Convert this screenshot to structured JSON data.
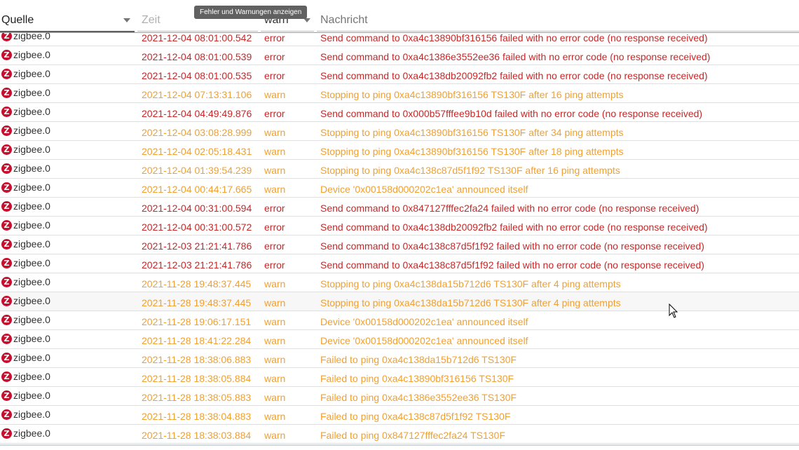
{
  "header": {
    "source": "Quelle",
    "time": "Zeit",
    "severity": "warn",
    "message": "Nachricht",
    "tooltip": "Fehler und Warnungen anzeigen"
  },
  "colors": {
    "error": "#c62828",
    "warn": "#f0a030",
    "zigbee_icon": "#c8102e"
  },
  "rows": [
    {
      "source": "zigbee.0",
      "time": "2021-12-04 08:01:00.542",
      "severity": "error",
      "message": "Send command to 0xa4c13890bf316156 failed with no error code (no response received)"
    },
    {
      "source": "zigbee.0",
      "time": "2021-12-04 08:01:00.539",
      "severity": "error",
      "message": "Send command to 0xa4c1386e3552ee36 failed with no error code (no response received)"
    },
    {
      "source": "zigbee.0",
      "time": "2021-12-04 08:01:00.535",
      "severity": "error",
      "message": "Send command to 0xa4c138db20092fb2 failed with no error code (no response received)"
    },
    {
      "source": "zigbee.0",
      "time": "2021-12-04 07:13:31.106",
      "severity": "warn",
      "message": "Stopping to ping 0xa4c13890bf316156 TS130F after 16 ping attempts"
    },
    {
      "source": "zigbee.0",
      "time": "2021-12-04 04:49:49.876",
      "severity": "error",
      "message": "Send command to 0x000b57fffee9b10d failed with no error code (no response received)"
    },
    {
      "source": "zigbee.0",
      "time": "2021-12-04 03:08:28.999",
      "severity": "warn",
      "message": "Stopping to ping 0xa4c13890bf316156 TS130F after 34 ping attempts"
    },
    {
      "source": "zigbee.0",
      "time": "2021-12-04 02:05:18.431",
      "severity": "warn",
      "message": "Stopping to ping 0xa4c13890bf316156 TS130F after 18 ping attempts"
    },
    {
      "source": "zigbee.0",
      "time": "2021-12-04 01:39:54.239",
      "severity": "warn",
      "message": "Stopping to ping 0xa4c138c87d5f1f92 TS130F after 16 ping attempts"
    },
    {
      "source": "zigbee.0",
      "time": "2021-12-04 00:44:17.665",
      "severity": "warn",
      "message": "Device '0x00158d000202c1ea' announced itself"
    },
    {
      "source": "zigbee.0",
      "time": "2021-12-04 00:31:00.594",
      "severity": "error",
      "message": "Send command to 0x847127fffec2fa24 failed with no error code (no response received)"
    },
    {
      "source": "zigbee.0",
      "time": "2021-12-04 00:31:00.572",
      "severity": "error",
      "message": "Send command to 0xa4c138db20092fb2 failed with no error code (no response received)"
    },
    {
      "source": "zigbee.0",
      "time": "2021-12-03 21:21:41.786",
      "severity": "error",
      "message": "Send command to 0xa4c138c87d5f1f92 failed with no error code (no response received)"
    },
    {
      "source": "zigbee.0",
      "time": "2021-12-03 21:21:41.786",
      "severity": "error",
      "message": "Send command to 0xa4c138c87d5f1f92 failed with no error code (no response received)"
    },
    {
      "source": "zigbee.0",
      "time": "2021-11-28 19:48:37.445",
      "severity": "warn",
      "message": "Stopping to ping 0xa4c138da15b712d6 TS130F after 4 ping attempts"
    },
    {
      "source": "zigbee.0",
      "time": "2021-11-28 19:48:37.445",
      "severity": "warn",
      "message": "Stopping to ping 0xa4c138da15b712d6 TS130F after 4 ping attempts"
    },
    {
      "source": "zigbee.0",
      "time": "2021-11-28 19:06:17.151",
      "severity": "warn",
      "message": "Device '0x00158d000202c1ea' announced itself"
    },
    {
      "source": "zigbee.0",
      "time": "2021-11-28 18:41:22.284",
      "severity": "warn",
      "message": "Device '0x00158d000202c1ea' announced itself"
    },
    {
      "source": "zigbee.0",
      "time": "2021-11-28 18:38:06.883",
      "severity": "warn",
      "message": "Failed to ping 0xa4c138da15b712d6 TS130F"
    },
    {
      "source": "zigbee.0",
      "time": "2021-11-28 18:38:05.884",
      "severity": "warn",
      "message": "Failed to ping 0xa4c13890bf316156 TS130F"
    },
    {
      "source": "zigbee.0",
      "time": "2021-11-28 18:38:05.883",
      "severity": "warn",
      "message": "Failed to ping 0xa4c1386e3552ee36 TS130F"
    },
    {
      "source": "zigbee.0",
      "time": "2021-11-28 18:38:04.883",
      "severity": "warn",
      "message": "Failed to ping 0xa4c138c87d5f1f92 TS130F"
    },
    {
      "source": "zigbee.0",
      "time": "2021-11-28 18:38:03.884",
      "severity": "warn",
      "message": "Failed to ping 0x847127fffec2fa24 TS130F"
    }
  ]
}
